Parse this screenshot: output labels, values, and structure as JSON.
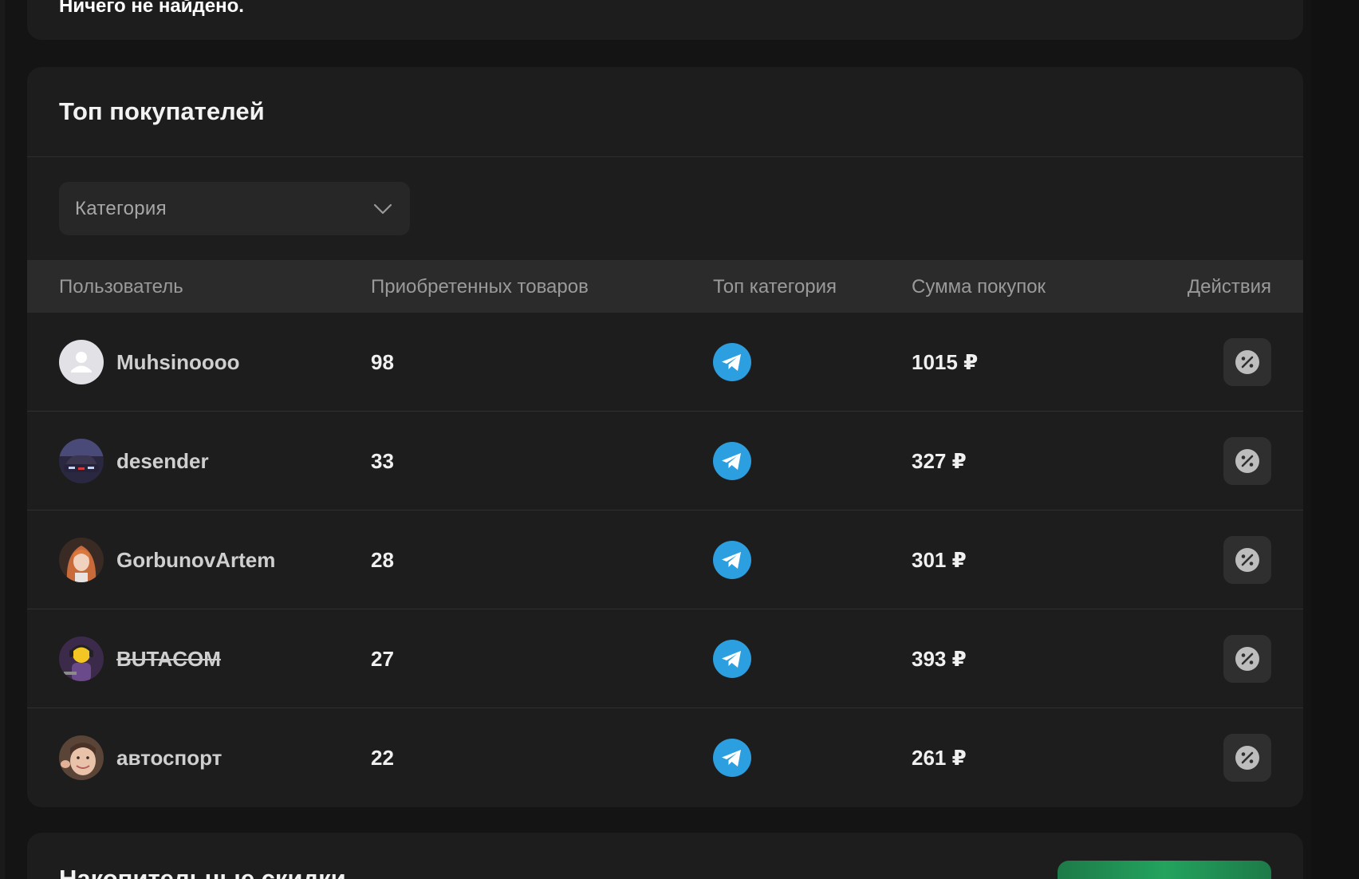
{
  "previous_section": {
    "empty_text": "Ничего не найдено."
  },
  "top_buyers": {
    "title": "Топ покупателей",
    "category_select": {
      "placeholder": "Категория"
    },
    "columns": {
      "user": "Пользователь",
      "count": "Приобретенных товаров",
      "category": "Топ категория",
      "sum": "Сумма покупок",
      "actions": "Действия"
    },
    "rows": [
      {
        "user": "Muhsinoooo",
        "count": "98",
        "sum": "1015 ₽",
        "category_icon": "telegram-icon",
        "avatar": "default-user-avatar",
        "strikethrough": false
      },
      {
        "user": "desender",
        "count": "33",
        "sum": "327 ₽",
        "category_icon": "telegram-icon",
        "avatar": "car-photo-avatar",
        "strikethrough": false
      },
      {
        "user": "GorbunovArtem",
        "count": "28",
        "sum": "301 ₽",
        "category_icon": "telegram-icon",
        "avatar": "anime-girl-avatar",
        "strikethrough": false
      },
      {
        "user": "BUTACOM",
        "count": "27",
        "sum": "393 ₽",
        "category_icon": "telegram-icon",
        "avatar": "cartoon-character-avatar",
        "strikethrough": true
      },
      {
        "user": "автоспорт",
        "count": "22",
        "sum": "261 ₽",
        "category_icon": "telegram-icon",
        "avatar": "child-photo-avatar",
        "strikethrough": false
      }
    ],
    "action_icon": "discount-percent-icon"
  },
  "next_section": {
    "title": "Накопительные скидки"
  },
  "colors": {
    "background": "#141414",
    "card": "#1d1d1d",
    "telegram": "#2b9fe0",
    "accent_green": "#23a35e"
  }
}
